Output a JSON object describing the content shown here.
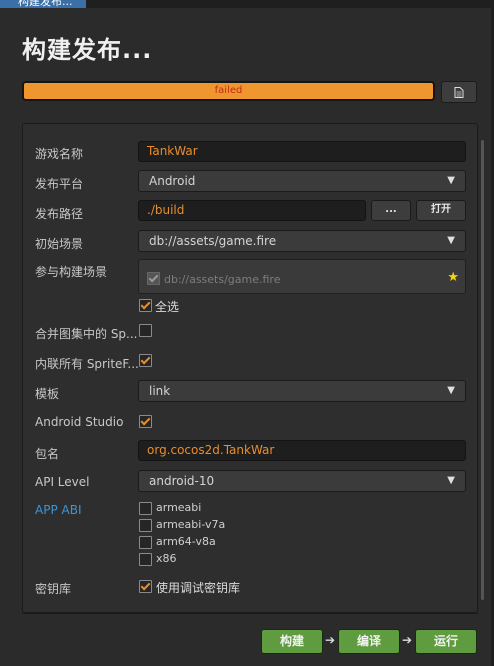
{
  "window": {
    "tab_title": "构建发布..."
  },
  "header": {
    "title": "构建发布..."
  },
  "progress": {
    "status": "failed",
    "percent": 100,
    "color": "#f0962e"
  },
  "form": {
    "game_name": {
      "label": "游戏名称",
      "value": "TankWar"
    },
    "platform": {
      "label": "发布平台",
      "value": "Android"
    },
    "build_path": {
      "label": "发布路径",
      "value": "./build",
      "browse_label": "...",
      "open_label": "打开"
    },
    "start_scene": {
      "label": "初始场景",
      "value": "db://assets/game.fire"
    },
    "scenes": {
      "label": "参与构建场景",
      "item": "db://assets/game.fire",
      "select_all_label": "全选",
      "select_all_checked": true
    },
    "merge_atlas": {
      "label": "合并图集中的 Sp...",
      "checked": false
    },
    "inline_sprite": {
      "label": "内联所有 SpriteF...",
      "checked": true
    },
    "template": {
      "label": "模板",
      "value": "link"
    },
    "android_studio": {
      "label": "Android Studio",
      "checked": true
    },
    "package_name": {
      "label": "包名",
      "value": "org.cocos2d.TankWar"
    },
    "api_level": {
      "label": "API Level",
      "value": "android-10"
    },
    "app_abi": {
      "label": "APP ABI",
      "options": [
        {
          "name": "armeabi",
          "checked": false
        },
        {
          "name": "armeabi-v7a",
          "checked": false
        },
        {
          "name": "arm64-v8a",
          "checked": false
        },
        {
          "name": "x86",
          "checked": false
        }
      ]
    },
    "keystore": {
      "label": "密钥库",
      "option_label": "使用调试密钥库",
      "checked": true
    }
  },
  "actions": {
    "build": "构建",
    "compile": "编译",
    "run": "运行",
    "accent": "#5e9c3f"
  }
}
